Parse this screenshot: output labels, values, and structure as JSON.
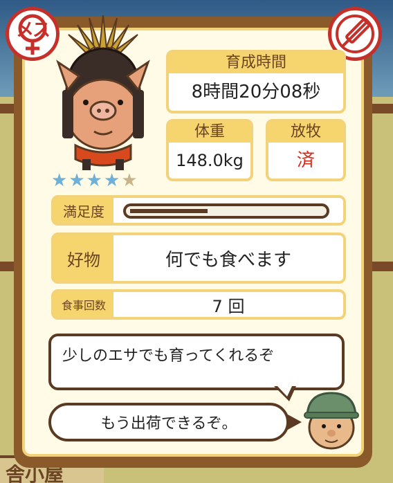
{
  "badges": {
    "gender_text": "メス",
    "gender_icon": "female-icon",
    "medicine_icon": "syringe-icon"
  },
  "rarity": {
    "stars_filled": 4,
    "stars_total": 5
  },
  "stats": {
    "time_label": "育成時間",
    "time_value": "8時間20分08秒",
    "weight_label": "体重",
    "weight_value": "148.0kg",
    "graze_label": "放牧",
    "graze_value": "済"
  },
  "satisfaction": {
    "label": "満足度",
    "level": 0.4
  },
  "favorite": {
    "label": "好物",
    "value": "何でも食べます"
  },
  "meals": {
    "label": "食事回数",
    "value": "7 回"
  },
  "dialogue": {
    "line1": "少しのエサでも育ってくれるぞ",
    "line2": "もう出荷できるぞ。"
  },
  "background": {
    "sign_text": "舎小屋"
  },
  "colors": {
    "frame": "#8b5a2b",
    "label_bg": "#f6d56f",
    "accent_red": "#c6302a",
    "star_on": "#6fb0d8"
  }
}
